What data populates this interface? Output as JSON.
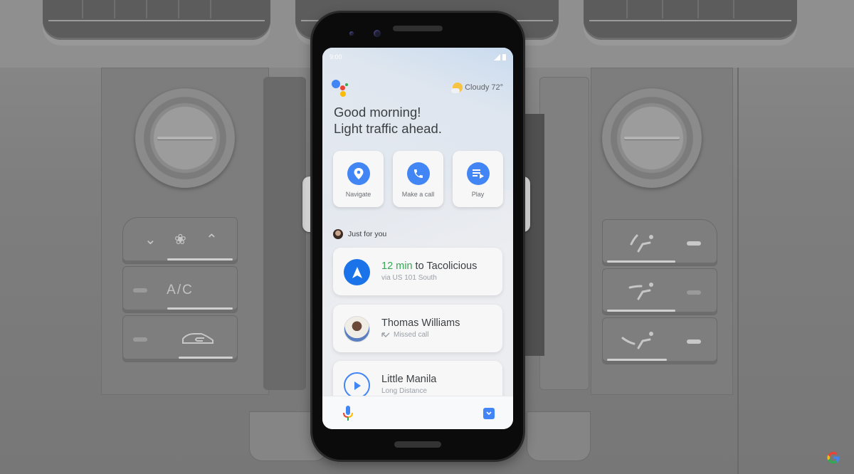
{
  "scene": {
    "description": "Phone mounted on car dashboard showing Google Assistant driving mode",
    "hvac_left": {
      "fan_controls": [
        "fan-down",
        "fan",
        "fan-up"
      ],
      "ac_label": "A/C",
      "recirculate_icon": "recirculate-icon"
    },
    "hvac_right": {
      "airflow_modes": [
        "airflow-face-icon",
        "airflow-body-icon",
        "airflow-feet-icon"
      ]
    },
    "watermark_icon": "google-g-logo"
  },
  "phone": {
    "status_bar": {
      "time": "9:00",
      "icons": [
        "signal-icon",
        "battery-icon"
      ]
    },
    "assistant_logo": "google-assistant-icon",
    "weather": {
      "condition": "Cloudy",
      "temperature": "72°",
      "icon": "partly-cloudy-icon"
    },
    "greeting": {
      "line1": "Good morning!",
      "line2": "Light traffic ahead."
    },
    "quick_actions": [
      {
        "label": "Navigate",
        "icon": "location-pin-icon"
      },
      {
        "label": "Make a call",
        "icon": "phone-icon"
      },
      {
        "label": "Play",
        "icon": "playlist-play-icon"
      }
    ],
    "section_title": "Just for you",
    "cards": [
      {
        "highlight": "12 min",
        "title_rest": " to Tacolicious",
        "subtitle": "via US 101 South",
        "icon": "navigation-arrow-icon"
      },
      {
        "title": "Thomas Williams",
        "subtitle": "Missed call",
        "icon": "contact-avatar",
        "sub_icon": "missed-call-icon"
      },
      {
        "title": "Little Manila",
        "subtitle": "Long Distance",
        "icon": "play-icon"
      }
    ],
    "bottom_bar": {
      "mic_icon": "microphone-icon",
      "keyboard_icon": "keyboard-toggle-icon"
    }
  },
  "colors": {
    "accent_blue": "#4285f4",
    "highlight_green": "#34a853",
    "text_primary": "#3c4043",
    "text_secondary": "#9aa0a6"
  }
}
